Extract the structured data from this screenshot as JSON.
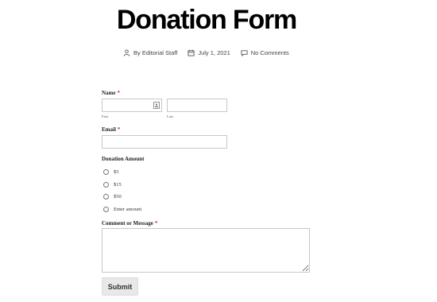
{
  "post": {
    "title": "Donation Form",
    "author": "By Editorial Staff",
    "date": "July 1, 2021",
    "comments": "No Comments"
  },
  "form": {
    "name_label": "Name",
    "required_mark": "*",
    "first_sublabel": "First",
    "last_sublabel": "Last",
    "email_label": "Email",
    "donation_label": "Donation Amount",
    "donation_options": [
      "$5",
      "$15",
      "$50",
      "Enter amount"
    ],
    "comment_label": "Comment or Message",
    "submit_label": "Submit"
  },
  "colors": {
    "required": "#c0392b",
    "button_bg": "#e8e8e8",
    "input_border": "#c8c8c8"
  },
  "icons": {
    "author": "person-icon",
    "date": "calendar-icon",
    "comments": "comment-bubble-icon",
    "name_field": "contact-card-icon"
  }
}
